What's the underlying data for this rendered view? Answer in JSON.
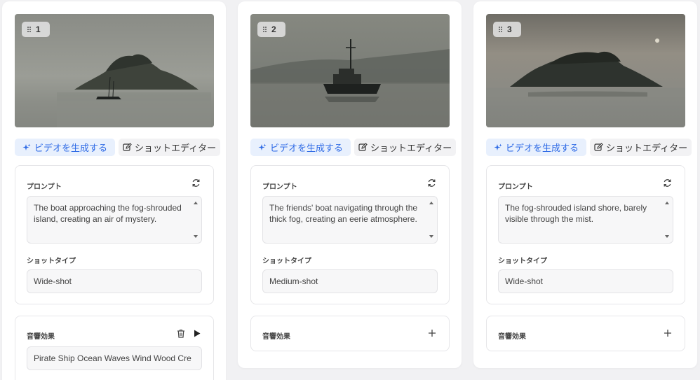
{
  "actions": {
    "generate_video": "ビデオを生成する",
    "shot_editor": "ショットエディター"
  },
  "labels": {
    "prompt": "プロンプト",
    "shot_type": "ショットタイプ",
    "sound_effects": "音響効果"
  },
  "colors": {
    "accent": "#2f6be6",
    "accent_bg": "#e8f0fd",
    "card_bg": "#ffffff",
    "page_bg": "#f1f1f3"
  },
  "icons": [
    "grip-icon",
    "sparkle-icon",
    "edit-icon",
    "refresh-icon",
    "trash-icon",
    "play-icon",
    "plus-icon"
  ],
  "shots": [
    {
      "number": "1",
      "prompt": "The boat approaching the fog-shrouded island, creating an air of mystery.",
      "shot_type": "Wide-shot",
      "sound_effect": "Pirate Ship Ocean Waves Wind Wood Cre"
    },
    {
      "number": "2",
      "prompt": "The friends' boat navigating through the thick fog, creating an eerie atmosphere.",
      "shot_type": "Medium-shot"
    },
    {
      "number": "3",
      "prompt": "The fog-shrouded island shore, barely visible through the mist.",
      "shot_type": "Wide-shot"
    }
  ]
}
